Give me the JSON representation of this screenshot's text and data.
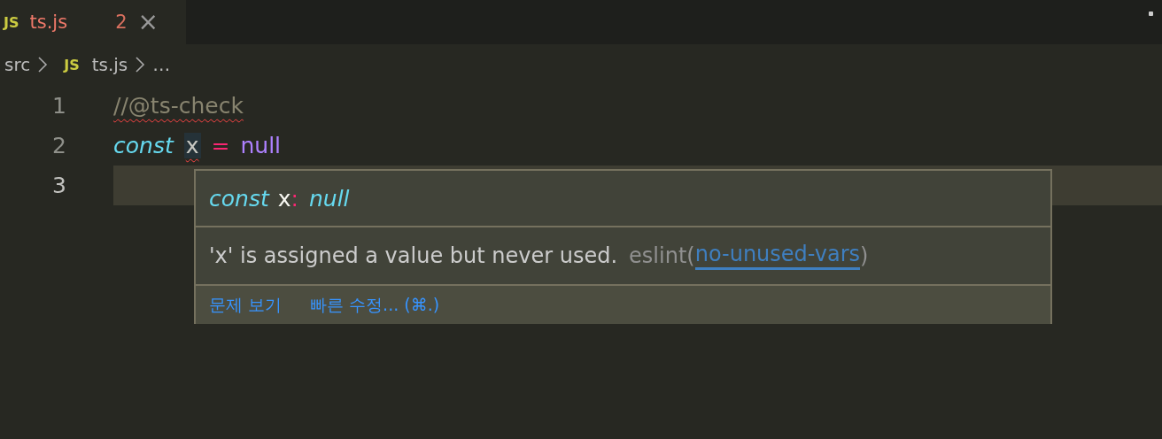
{
  "tab": {
    "icon_text": "JS",
    "name": "ts.js",
    "problem_count": "2",
    "close": "×",
    "selected": true
  },
  "breadcrumbs": [
    {
      "kind": "folder",
      "text": "src"
    },
    {
      "kind": "file",
      "icon_text": "JS",
      "text": "ts.js"
    },
    {
      "kind": "more",
      "text": "…"
    }
  ],
  "code_lines": [
    {
      "number": "1",
      "current": false,
      "tokens": [
        {
          "text": "//@ts-check",
          "kind": "comment",
          "squiggle": true,
          "highlighted": false
        }
      ]
    },
    {
      "number": "2",
      "current": false,
      "tokens": [
        {
          "text": "const",
          "kind": "keyword",
          "squiggle": false,
          "highlighted": false
        },
        {
          "text": "x",
          "kind": "variable",
          "squiggle": true,
          "highlighted": true
        },
        {
          "text": "=",
          "kind": "operator",
          "squiggle": false,
          "highlighted": false
        },
        {
          "text": "null",
          "kind": "constant",
          "squiggle": false,
          "highlighted": false
        }
      ]
    },
    {
      "number": "3",
      "current": true
    }
  ],
  "hover": {
    "signature": [
      {
        "text": "const",
        "kind": "keyword"
      },
      {
        "text": "x",
        "kind": "name"
      },
      {
        "text": ":",
        "kind": "punct"
      },
      {
        "text": "null",
        "kind": "type"
      }
    ],
    "message": "'x' is assigned a value but never used.",
    "source": "eslint(",
    "rule_link": "no-unused-vars",
    "source_end": ")",
    "actions": [
      "문제 보기",
      "빠른 수정... (⌘.)"
    ]
  }
}
